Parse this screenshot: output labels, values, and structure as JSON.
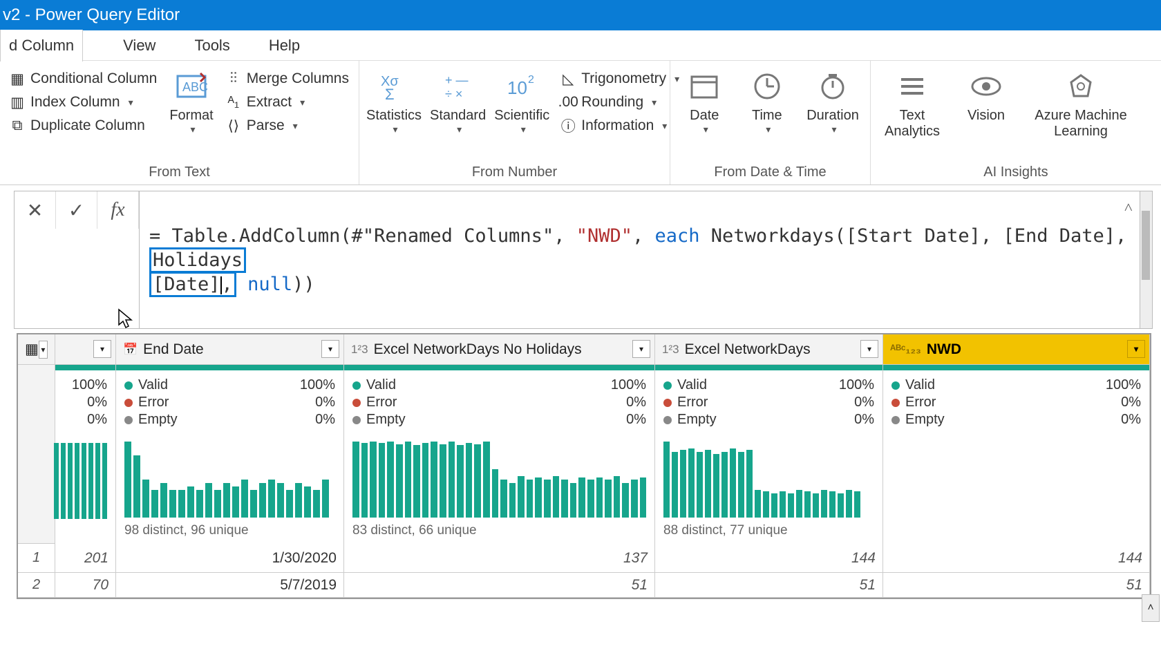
{
  "title": "v2 - Power Query Editor",
  "menu": {
    "active": "d Column",
    "items": [
      "View",
      "Tools",
      "Help"
    ]
  },
  "ribbon": {
    "group1": {
      "conditional": "Conditional Column",
      "index": "Index Column",
      "duplicate": "Duplicate Column",
      "format": "Format",
      "merge": "Merge Columns",
      "extract": "Extract",
      "parse": "Parse",
      "label": "From Text"
    },
    "group2": {
      "statistics": "Statistics",
      "standard": "Standard",
      "scientific": "Scientific",
      "trig": "Trigonometry",
      "rounding": "Rounding",
      "information": "Information",
      "label": "From Number"
    },
    "group3": {
      "date": "Date",
      "time": "Time",
      "duration": "Duration",
      "label": "From Date & Time"
    },
    "group4": {
      "text": "Text Analytics",
      "vision": "Vision",
      "aml": "Azure Machine Learning",
      "label": "AI Insights"
    }
  },
  "formula": {
    "prefix": "= Table.AddColumn(#\"Renamed Columns\", ",
    "nwd_str": "\"NWD\"",
    "mid1": ", ",
    "each": "each",
    "mid2": " Networkdays([Start Date], [End Date],",
    "holidays": "Holidays",
    "line2_pre": "[Date]",
    "line2_mid": ", ",
    "nullkw": "null",
    "line2_post": "))"
  },
  "columns": {
    "rowcorner": "",
    "end": "End Date",
    "exh": "Excel NetworkDays No Holidays",
    "exn": "Excel NetworkDays",
    "nwd": "NWD"
  },
  "profile": {
    "valid": "Valid",
    "error": "Error",
    "empty": "Empty",
    "p100": "100%",
    "p0": "0%",
    "idx": {
      "a": "100%",
      "b": "0%",
      "c": "0%"
    },
    "end_distinct": "98 distinct, 96 unique",
    "exh_distinct": "83 distinct, 66 unique",
    "exn_distinct": "88 distinct, 77 unique"
  },
  "rows": [
    {
      "n": "1",
      "idx": "201",
      "end": "1/30/2020",
      "exh": "137",
      "exn": "144",
      "nwd": "144"
    },
    {
      "n": "2",
      "idx": "70",
      "end": "5/7/2019",
      "exh": "51",
      "exn": "51",
      "nwd": "51"
    }
  ],
  "chart_data": [
    {
      "type": "bar",
      "title": "Index column profile histogram",
      "values": [
        110,
        110,
        110,
        110,
        110,
        110,
        110,
        110
      ]
    },
    {
      "type": "bar",
      "title": "End Date profile histogram",
      "values": [
        110,
        90,
        55,
        40,
        50,
        40,
        40,
        45,
        40,
        50,
        40,
        50,
        45,
        55,
        40,
        50,
        55,
        50,
        40,
        50,
        45,
        40,
        55
      ]
    },
    {
      "type": "bar",
      "title": "Excel NetworkDays No Holidays profile histogram",
      "values": [
        110,
        108,
        110,
        108,
        110,
        106,
        110,
        105,
        108,
        110,
        106,
        110,
        105,
        108,
        106,
        110,
        70,
        55,
        50,
        60,
        55,
        58,
        55,
        60,
        55,
        50,
        58,
        55,
        58,
        55,
        60,
        50,
        55,
        58
      ]
    },
    {
      "type": "bar",
      "title": "Excel NetworkDays profile histogram",
      "values": [
        110,
        95,
        98,
        100,
        95,
        98,
        92,
        95,
        100,
        95,
        98,
        40,
        38,
        35,
        38,
        35,
        40,
        38,
        35,
        40,
        38,
        35,
        40,
        38
      ]
    }
  ]
}
